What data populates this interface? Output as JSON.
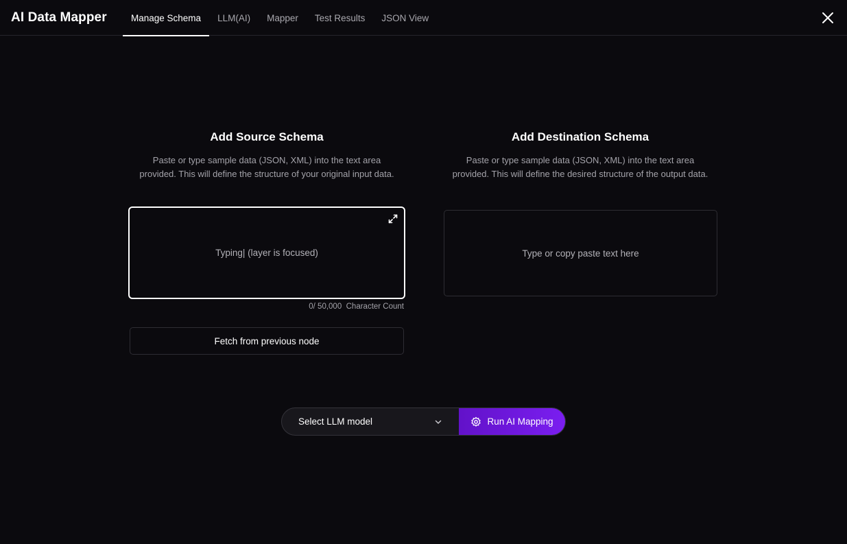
{
  "header": {
    "title": "AI Data Mapper",
    "tabs": [
      {
        "label": "Manage Schema",
        "active": true
      },
      {
        "label": "LLM(AI)",
        "active": false
      },
      {
        "label": "Mapper",
        "active": false
      },
      {
        "label": "Test Results",
        "active": false
      },
      {
        "label": "JSON View",
        "active": false
      }
    ],
    "close_icon": "close-icon"
  },
  "source": {
    "title": "Add Source Schema",
    "description": "Paste or type sample data (JSON, XML) into the text area provided. This will define the structure of your original input data.",
    "textarea_text": "Typing| (layer is focused)",
    "expand_icon": "expand-icon",
    "char_count_value": "0/ 50,000",
    "char_count_label": "Character Count",
    "fetch_label": "Fetch from previous node"
  },
  "destination": {
    "title": "Add Destination Schema",
    "description": "Paste or type sample data (JSON, XML) into the text area provided. This will define the desired structure of the output data.",
    "textarea_placeholder": "Type or copy paste text here"
  },
  "actions": {
    "llm_select_label": "Select LLM model",
    "run_label": "Run AI Mapping",
    "run_icon": "ai-sparkle-icon",
    "accent_color": "#6e17dd"
  }
}
